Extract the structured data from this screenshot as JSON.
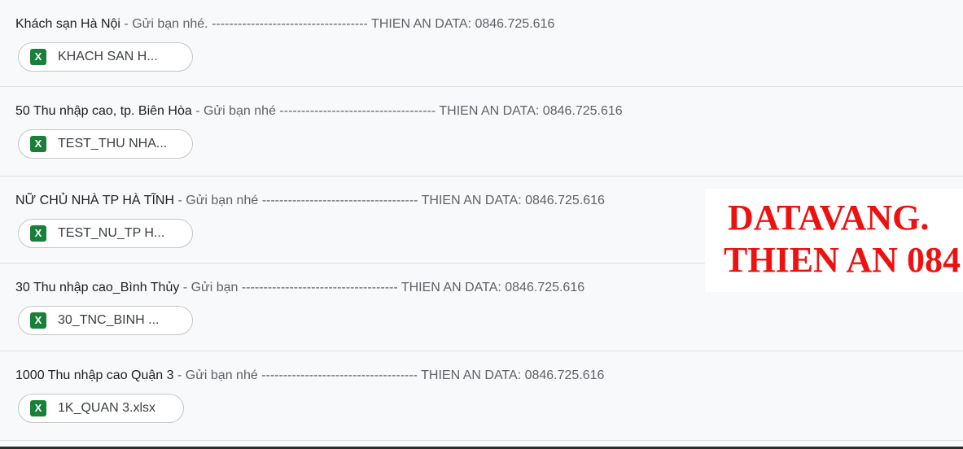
{
  "emails": [
    {
      "subject": "Khách sạn Hà Nội",
      "snippet": " - Gửi bạn nhé. ------------------------------------ THIEN AN DATA: 0846.725.616",
      "attachment": {
        "icon": "excel-icon",
        "icon_letter": "X",
        "name": "KHACH SAN H..."
      }
    },
    {
      "subject": "50 Thu nhập cao, tp. Biên Hòa",
      "snippet": " - Gửi bạn nhé ------------------------------------ THIEN AN DATA: 0846.725.616",
      "attachment": {
        "icon": "excel-icon",
        "icon_letter": "X",
        "name": "TEST_THU NHA..."
      }
    },
    {
      "subject": "NỮ CHỦ NHÀ TP HÀ TĨNH",
      "snippet": " - Gửi bạn nhé ------------------------------------ THIEN AN DATA: 0846.725.616",
      "attachment": {
        "icon": "excel-icon",
        "icon_letter": "X",
        "name": "TEST_NU_TP H..."
      }
    },
    {
      "subject": "30 Thu nhập cao_Bình Thủy",
      "snippet": " - Gửi bạn ------------------------------------ THIEN AN DATA: 0846.725.616",
      "attachment": {
        "icon": "excel-icon",
        "icon_letter": "X",
        "name": "30_TNC_BINH ..."
      }
    },
    {
      "subject": "1000 Thu nhập cao Quận 3",
      "snippet": " - Gửi bạn nhé ------------------------------------ THIEN AN DATA: 0846.725.616",
      "attachment": {
        "icon": "excel-icon",
        "icon_letter": "X",
        "name": "1K_QUAN 3.xlsx"
      }
    }
  ],
  "watermark": {
    "line1": "DATAVANG.",
    "line2": "THIEN AN 084"
  },
  "colors": {
    "background": "#f8f9fa",
    "subject": "#202124",
    "snippet": "#5f6368",
    "excel_green": "#188038",
    "watermark_red": "#ee1111"
  }
}
